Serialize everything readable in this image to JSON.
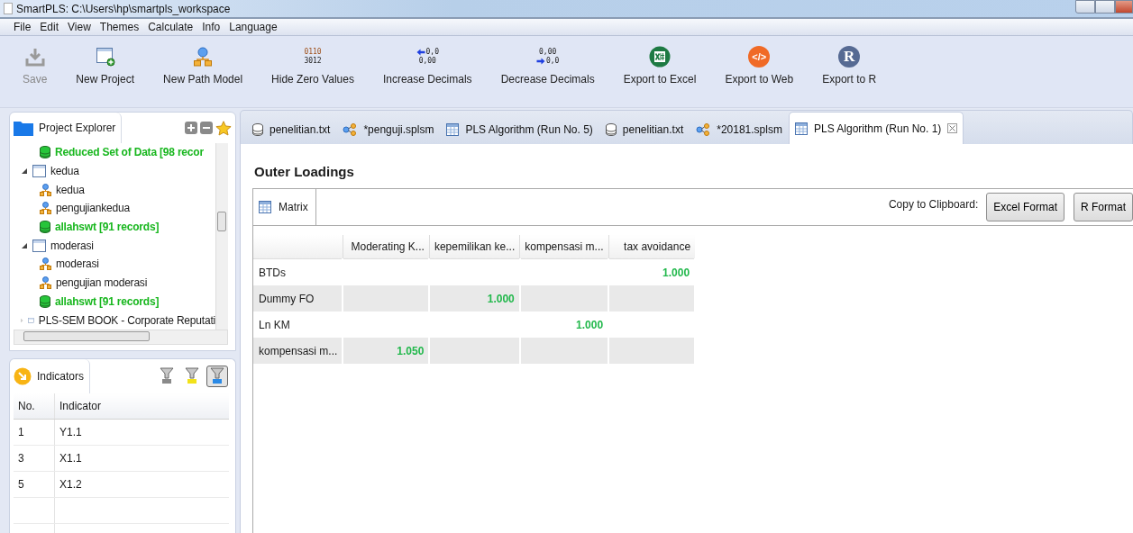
{
  "window": {
    "title": "SmartPLS: C:\\Users\\hp\\smartpls_workspace"
  },
  "menu": [
    "File",
    "Edit",
    "View",
    "Themes",
    "Calculate",
    "Info",
    "Language"
  ],
  "toolbar": [
    {
      "label": "Save",
      "kind": "save",
      "disabled": true
    },
    {
      "label": "New Project",
      "kind": "new-project",
      "disabled": false
    },
    {
      "label": "New Path Model",
      "kind": "path-model",
      "disabled": false
    },
    {
      "label": "Hide Zero Values",
      "kind": "digits",
      "disabled": false,
      "icon_lines": [
        "0110",
        "3012"
      ]
    },
    {
      "label": "Increase Decimals",
      "kind": "increase",
      "disabled": false,
      "icon_lines": [
        "0,0",
        "0,00"
      ]
    },
    {
      "label": "Decrease Decimals",
      "kind": "decrease",
      "disabled": false,
      "icon_lines": [
        "0,00",
        "0,0"
      ]
    },
    {
      "label": "Export to Excel",
      "kind": "excel",
      "disabled": false
    },
    {
      "label": "Export to Web",
      "kind": "web",
      "disabled": false,
      "icon_text": "</>"
    },
    {
      "label": "Export to R",
      "kind": "r",
      "disabled": false,
      "icon_text": "R"
    }
  ],
  "project_explorer": {
    "title": "Project Explorer",
    "tree": [
      {
        "children": [
          {
            "label": "Reduced Set of Data [98 recor",
            "kind": "dataset"
          }
        ]
      },
      {
        "label": "kedua",
        "kind": "project",
        "expanded": true,
        "children": [
          {
            "label": "kedua",
            "kind": "model"
          },
          {
            "label": "pengujiankedua",
            "kind": "model"
          },
          {
            "label": "allahswt [91 records]",
            "kind": "dataset"
          }
        ]
      },
      {
        "label": "moderasi",
        "kind": "project",
        "expanded": true,
        "children": [
          {
            "label": "moderasi",
            "kind": "model"
          },
          {
            "label": "pengujian moderasi",
            "kind": "model"
          },
          {
            "label": "allahswt [91 records]",
            "kind": "dataset"
          }
        ]
      },
      {
        "label": "PLS-SEM BOOK - Corporate Reputati",
        "kind": "project",
        "expanded": false
      }
    ]
  },
  "indicators": {
    "title": "Indicators",
    "filters": [
      {
        "color": "#8a8a8a",
        "selected": false
      },
      {
        "color": "#f2e21a",
        "selected": false
      },
      {
        "color": "#2b8ae6",
        "selected": true
      }
    ],
    "columns": [
      "No.",
      "Indicator"
    ],
    "rows": [
      [
        "1",
        "Y1.1"
      ],
      [
        "3",
        "X1.1"
      ],
      [
        "5",
        "X1.2"
      ]
    ]
  },
  "editor_tabs": [
    {
      "label": "penelitian.txt",
      "kind": "dataset",
      "selected": false
    },
    {
      "label": "*penguji.splsm",
      "kind": "model",
      "selected": false
    },
    {
      "label": "PLS Algorithm (Run No. 5)",
      "kind": "report",
      "selected": false
    },
    {
      "label": "penelitian.txt",
      "kind": "dataset",
      "selected": false
    },
    {
      "label": "*20181.splsm",
      "kind": "model",
      "selected": false
    },
    {
      "label": "PLS Algorithm (Run No. 1)",
      "kind": "report",
      "selected": true
    }
  ],
  "report": {
    "title": "Outer Loadings",
    "view_tab": "Matrix",
    "copy_label": "Copy to Clipboard:",
    "buttons": [
      "Excel Format",
      "R Format"
    ],
    "table": {
      "columns": [
        "Moderating K...",
        "kepemilikan ke...",
        "kompensasi m...",
        "tax avoidance"
      ],
      "rows": [
        {
          "label": "BTDs",
          "cells": [
            "",
            "",
            "",
            "1.000"
          ]
        },
        {
          "label": "Dummy FO",
          "cells": [
            "",
            "1.000",
            "",
            ""
          ]
        },
        {
          "label": "Ln KM",
          "cells": [
            "",
            "",
            "1.000",
            ""
          ]
        },
        {
          "label": "kompensasi m...",
          "cells": [
            "1.050",
            "",
            "",
            ""
          ]
        }
      ]
    }
  }
}
